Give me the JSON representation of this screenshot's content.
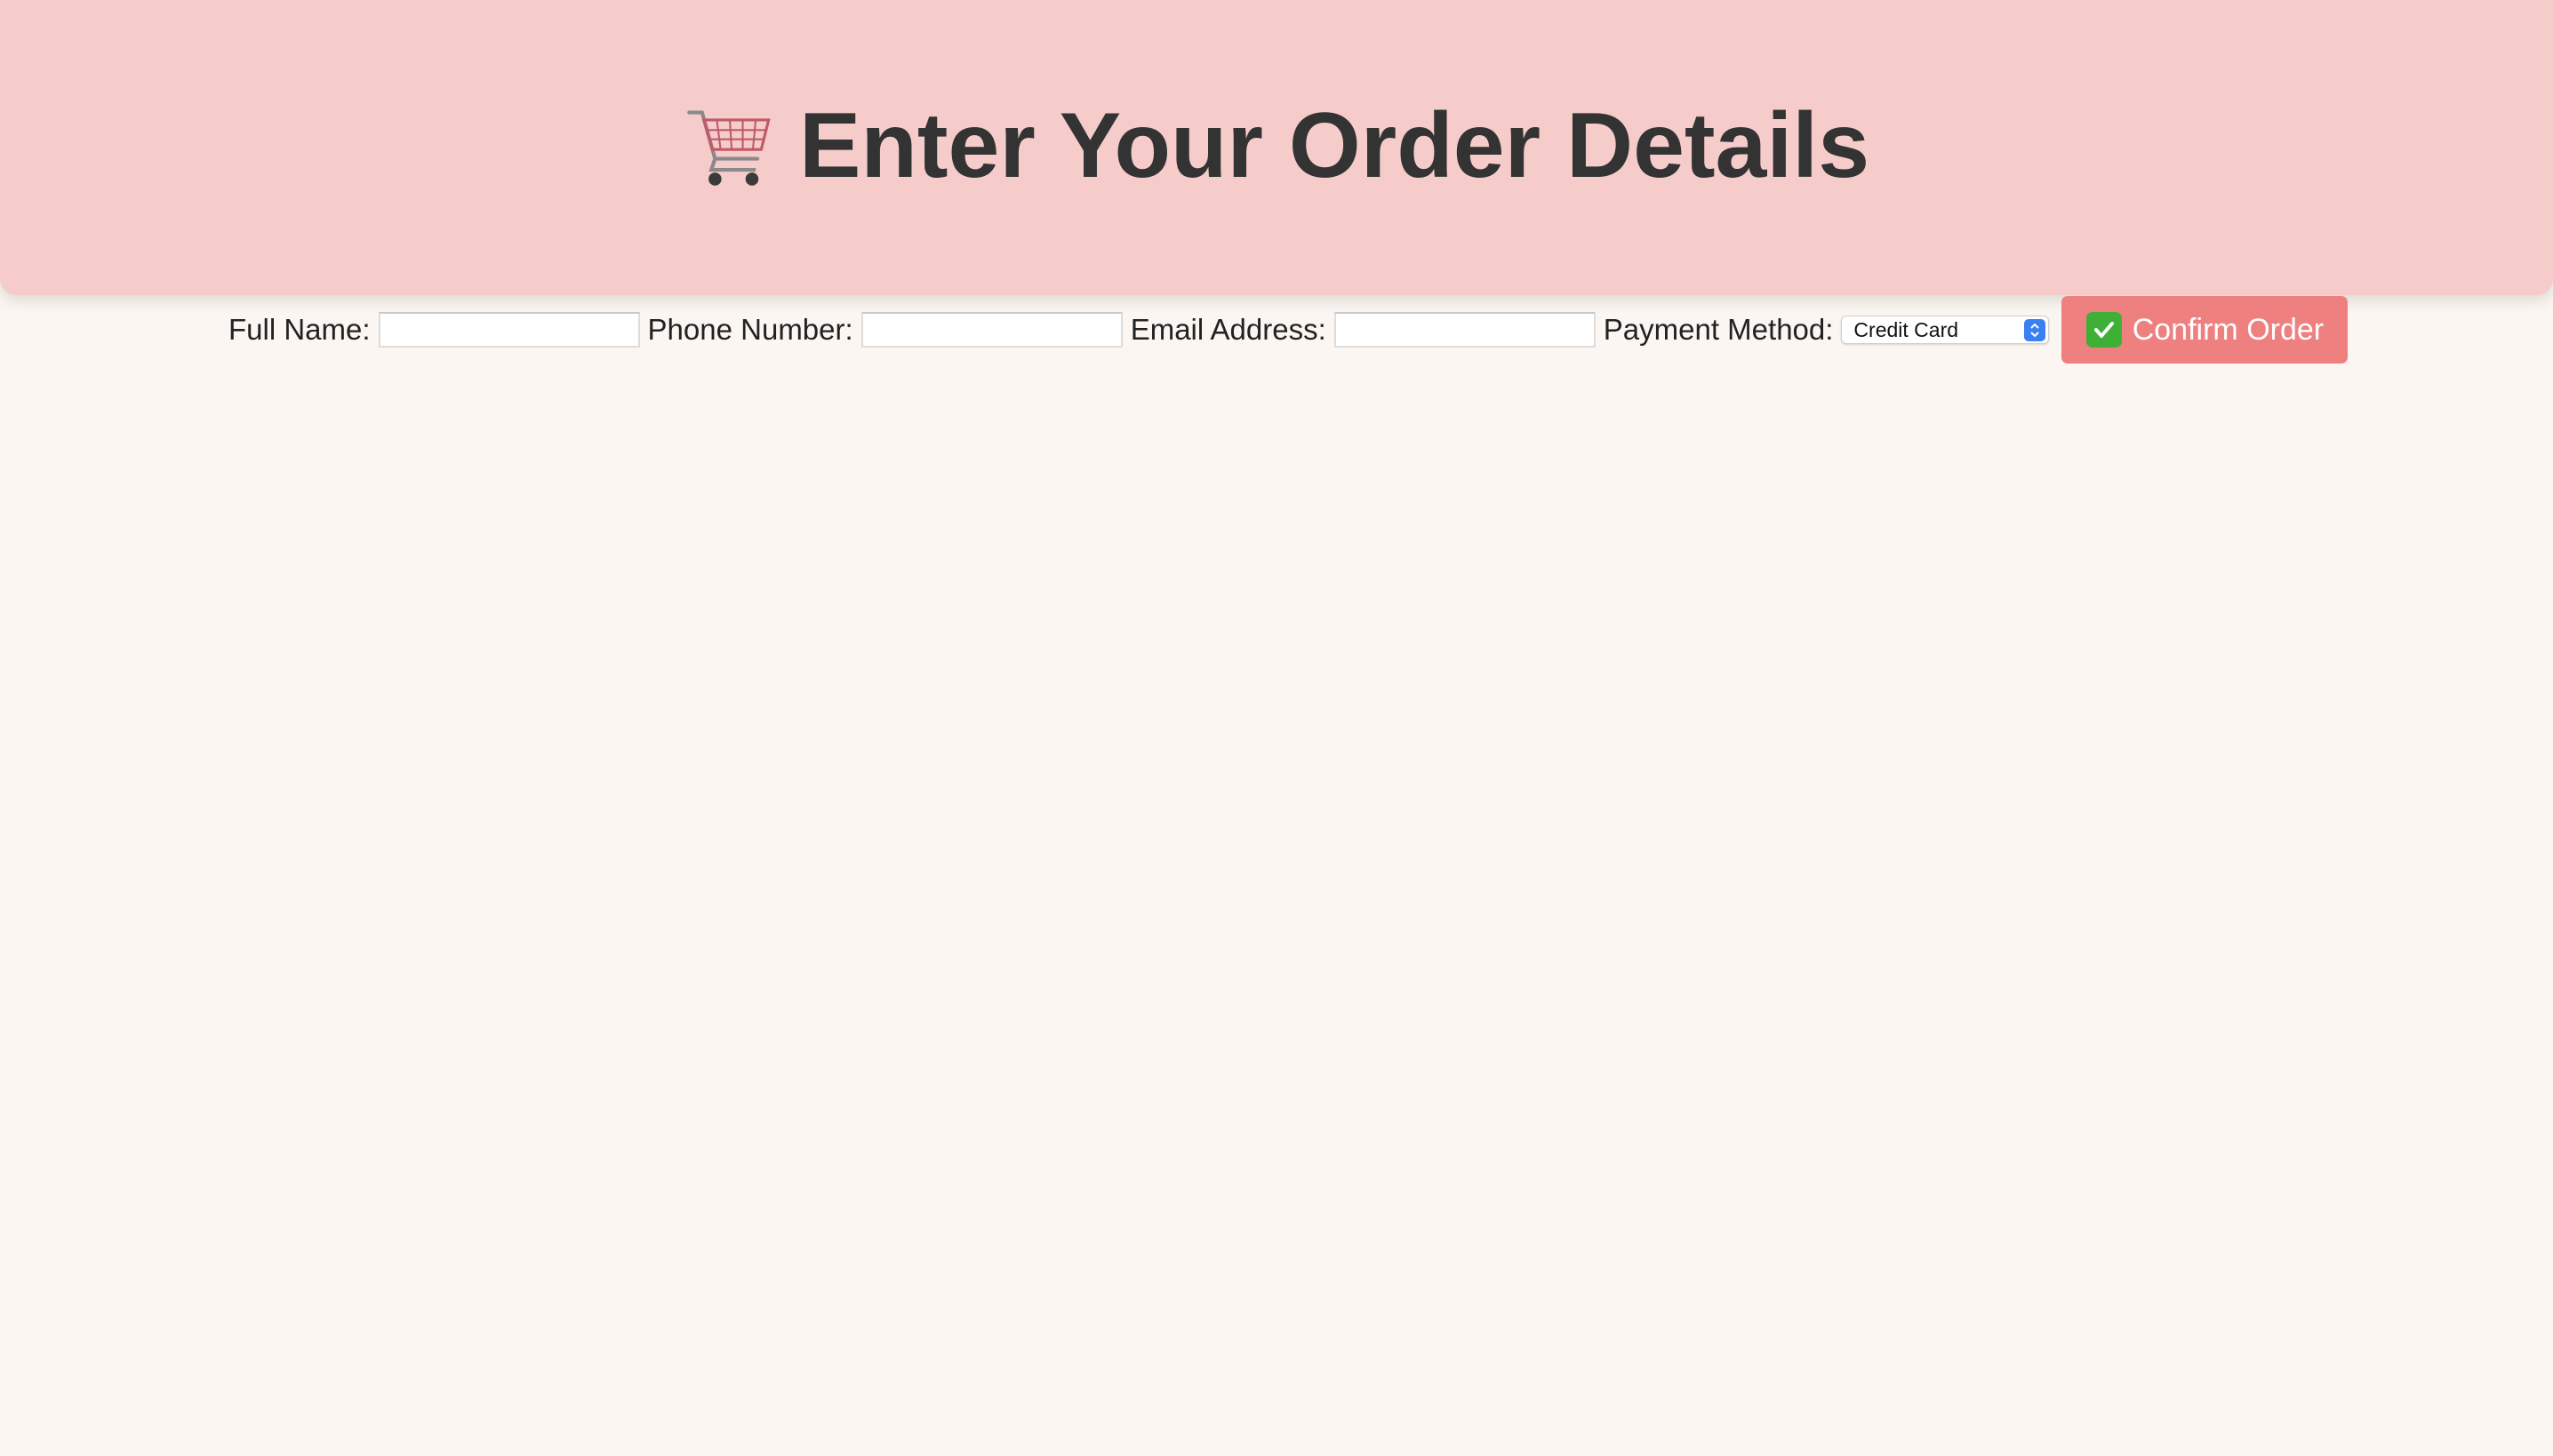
{
  "header": {
    "title": "Enter Your Order Details",
    "icon": "shopping-cart-icon"
  },
  "form": {
    "full_name_label": "Full Name:",
    "full_name_value": "",
    "phone_label": "Phone Number:",
    "phone_value": "",
    "email_label": "Email Address:",
    "email_value": "",
    "payment_label": "Payment Method:",
    "payment_selected": "Credit Card",
    "confirm_button": "Confirm Order",
    "confirm_icon": "check-mark-icon"
  },
  "colors": {
    "header_bg": "#f6cccb",
    "page_bg": "#fbf6f2",
    "button_bg": "#ee8180",
    "check_green": "#3eb035",
    "select_accent": "#3a80f2"
  }
}
